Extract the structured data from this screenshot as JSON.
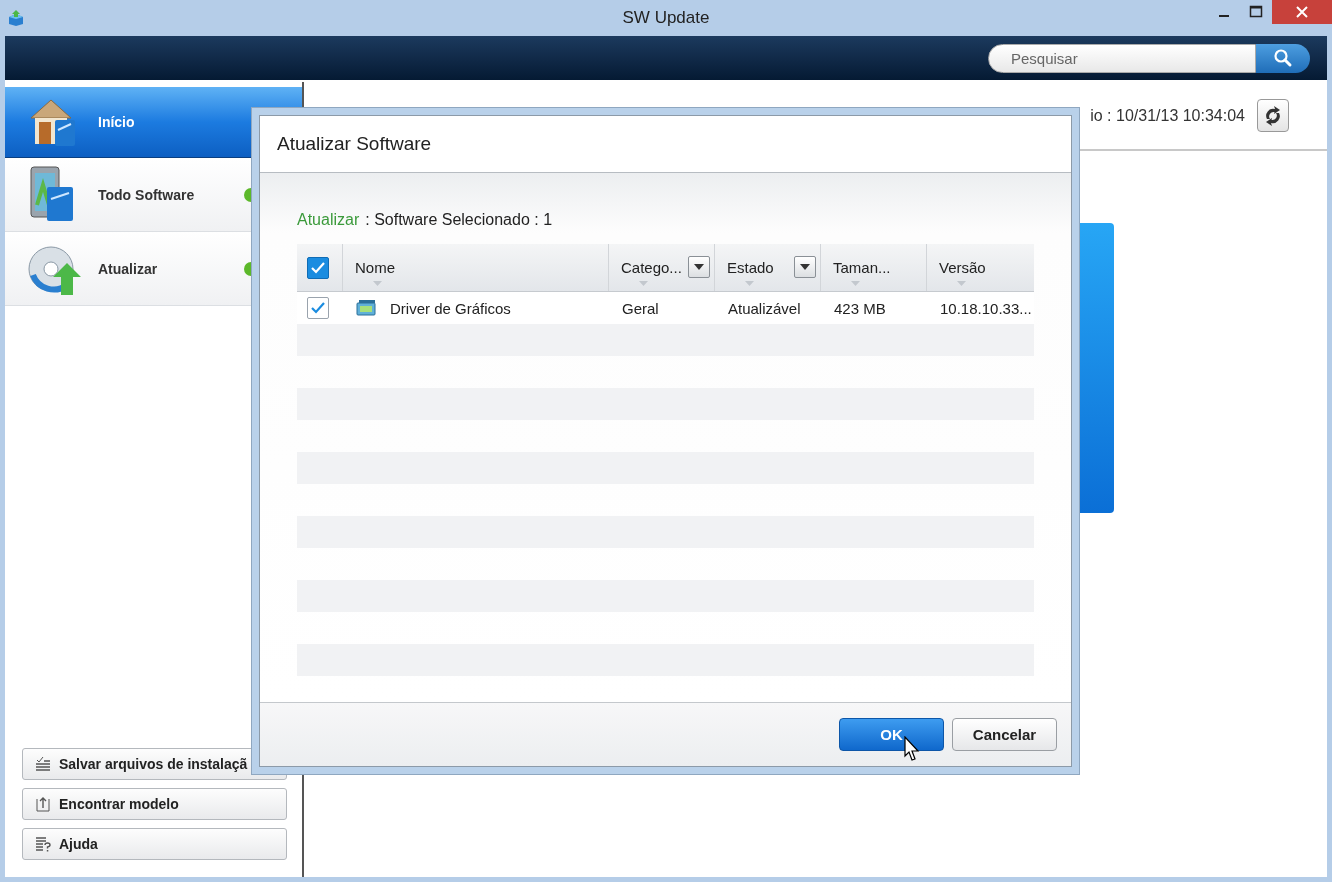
{
  "window": {
    "title": "SW Update"
  },
  "search": {
    "placeholder": "Pesquisar"
  },
  "sidebar": {
    "items": [
      {
        "label": "Início",
        "selected": true
      },
      {
        "label": "Todo Software",
        "selected": false
      },
      {
        "label": "Atualizar",
        "selected": false
      }
    ],
    "buttons": [
      {
        "label": "Salvar arquivos de instalaçã"
      },
      {
        "label": "Encontrar modelo"
      },
      {
        "label": "Ajuda"
      }
    ]
  },
  "main": {
    "last_check": "io : 10/31/13 10:34:04"
  },
  "dialog": {
    "title": "Atualizar Software",
    "summary_label": "Atualizar",
    "summary_text": ": Software Selecionado : 1",
    "table": {
      "select_all": true,
      "columns": [
        {
          "label": "Nome",
          "filter": false
        },
        {
          "label": "Catego...",
          "filter": true
        },
        {
          "label": "Estado",
          "filter": true
        },
        {
          "label": "Taman...",
          "filter": false
        },
        {
          "label": "Versão",
          "filter": false
        }
      ],
      "rows": [
        {
          "checked": true,
          "cells": [
            "Driver de Gráficos",
            "Geral",
            "Atualizável",
            "423 MB",
            "10.18.10.33..."
          ]
        }
      ]
    },
    "buttons": [
      {
        "label": "OK",
        "kind": "primary"
      },
      {
        "label": "Cancelar",
        "kind": "secondary"
      }
    ]
  }
}
